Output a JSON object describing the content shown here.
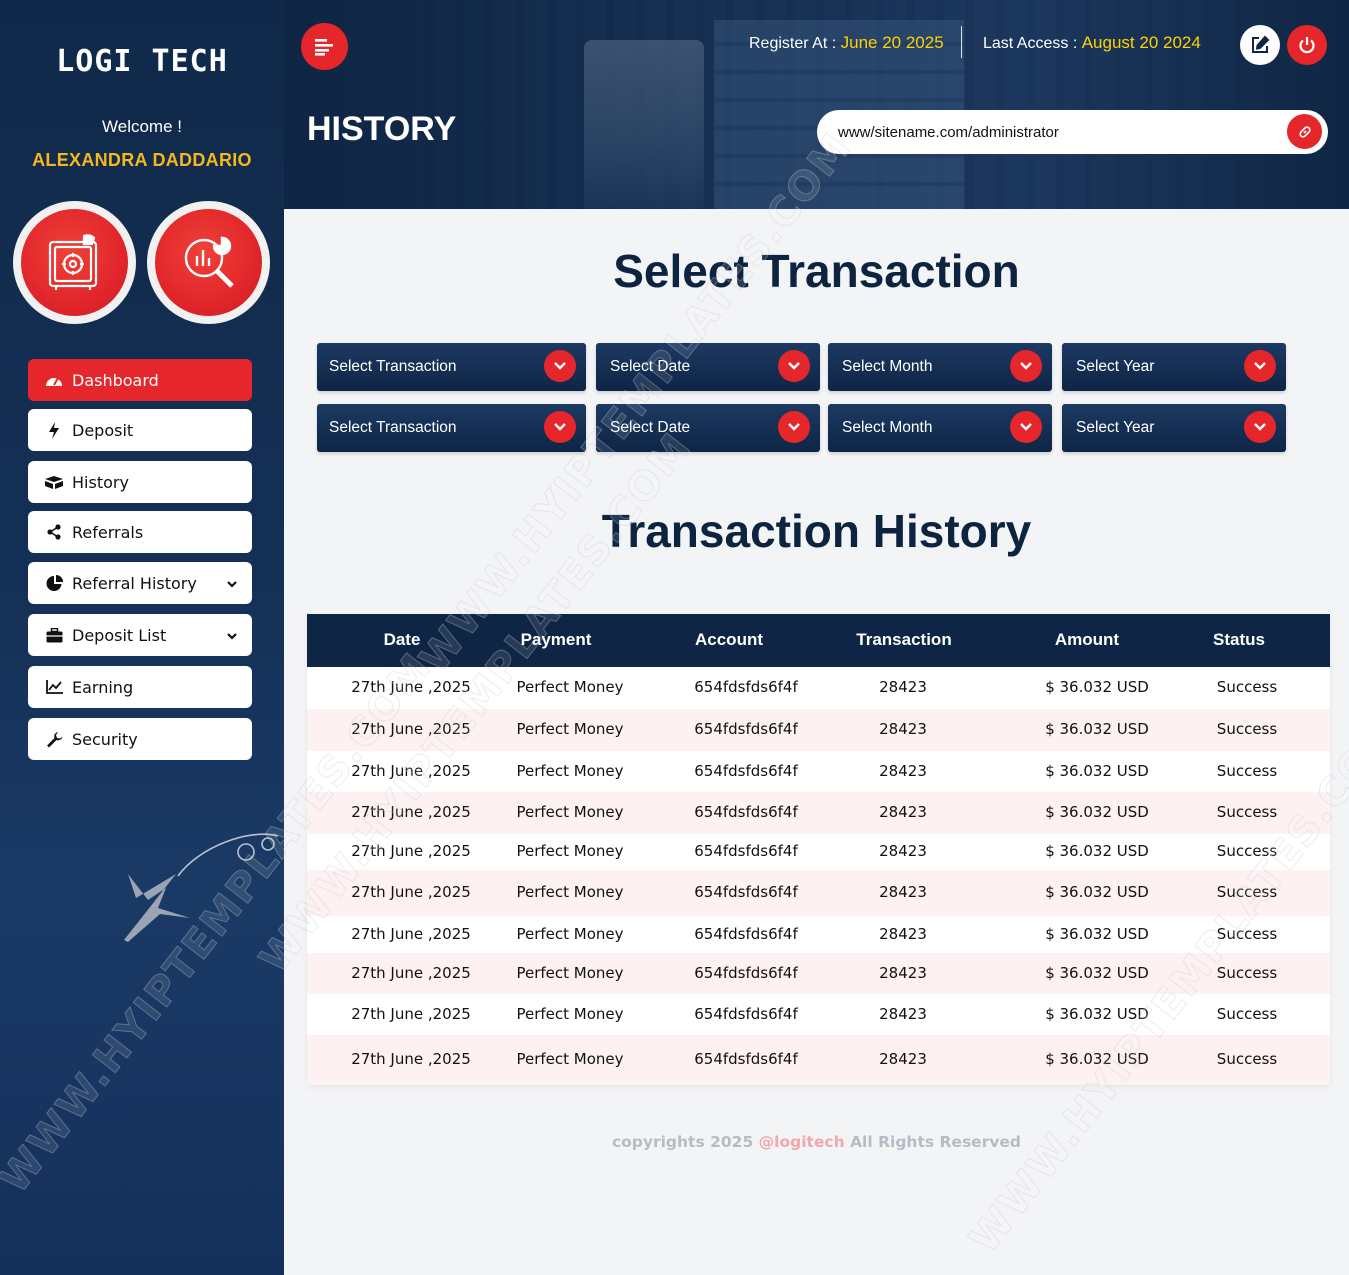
{
  "app": {
    "brand": "LOGI TECH",
    "welcome": "Welcome !",
    "username": "ALEXANDRA DADDARIO"
  },
  "sidebar": {
    "items": [
      {
        "label": "Dashboard",
        "icon": "dashboard-icon",
        "active": true
      },
      {
        "label": "Deposit",
        "icon": "bolt-icon"
      },
      {
        "label": "History",
        "icon": "boxes-icon"
      },
      {
        "label": "Referrals",
        "icon": "share-icon"
      },
      {
        "label": "Referral History",
        "icon": "pie-chart-icon",
        "has_submenu": true
      },
      {
        "label": "Deposit List",
        "icon": "briefcase-icon",
        "has_submenu": true
      },
      {
        "label": "Earning",
        "icon": "line-chart-icon"
      },
      {
        "label": "Security",
        "icon": "wrench-icon"
      }
    ]
  },
  "header": {
    "page_title": "HISTORY",
    "register_label": "Register At :",
    "register_value": "June 20 2025",
    "access_label": "Last Access :",
    "access_value": "August 20 2024",
    "url": "www/sitename.com/administrator"
  },
  "filters": {
    "title": "Select Transaction",
    "rows": [
      {
        "transaction": "Select Transaction",
        "date": "Select Date",
        "month": "Select Month",
        "year": "Select Year"
      },
      {
        "transaction": "Select Transaction",
        "date": "Select Date",
        "month": "Select Month",
        "year": "Select Year"
      }
    ]
  },
  "history": {
    "title": "Transaction History",
    "columns": [
      "Date",
      "Payment",
      "Account",
      "Transaction",
      "Amount",
      "Status"
    ],
    "rows": [
      [
        "27th June ,2025",
        "Perfect Money",
        "654fdsfds6f4f",
        "28423",
        "$ 36.032 USD",
        "Success"
      ],
      [
        "27th June ,2025",
        "Perfect Money",
        "654fdsfds6f4f",
        "28423",
        "$ 36.032 USD",
        "Success"
      ],
      [
        "27th June ,2025",
        "Perfect Money",
        "654fdsfds6f4f",
        "28423",
        "$ 36.032 USD",
        "Success"
      ],
      [
        "27th June ,2025",
        "Perfect Money",
        "654fdsfds6f4f",
        "28423",
        "$ 36.032 USD",
        "Success"
      ],
      [
        "27th June ,2025",
        "Perfect Money",
        "654fdsfds6f4f",
        "28423",
        "$ 36.032 USD",
        "Success"
      ],
      [
        "27th June ,2025",
        "Perfect Money",
        "654fdsfds6f4f",
        "28423",
        "$ 36.032 USD",
        "Success"
      ],
      [
        "27th June ,2025",
        "Perfect Money",
        "654fdsfds6f4f",
        "28423",
        "$ 36.032 USD",
        "Success"
      ],
      [
        "27th June ,2025",
        "Perfect Money",
        "654fdsfds6f4f",
        "28423",
        "$ 36.032 USD",
        "Success"
      ],
      [
        "27th June ,2025",
        "Perfect Money",
        "654fdsfds6f4f",
        "28423",
        "$ 36.032 USD",
        "Success"
      ],
      [
        "27th June ,2025",
        "Perfect Money",
        "654fdsfds6f4f",
        "28423",
        "$ 36.032 USD",
        "Success"
      ]
    ]
  },
  "footer": {
    "prefix": "copyrights 2025",
    "brand": "@logitech",
    "suffix": "All Rights Reserved"
  },
  "watermark": "WWW.HYIPTEMPLATES.COM",
  "colors": {
    "accent": "#e5262b",
    "navy": "#0e2545",
    "gold": "#f5b81c",
    "yellow": "#ffd200"
  }
}
